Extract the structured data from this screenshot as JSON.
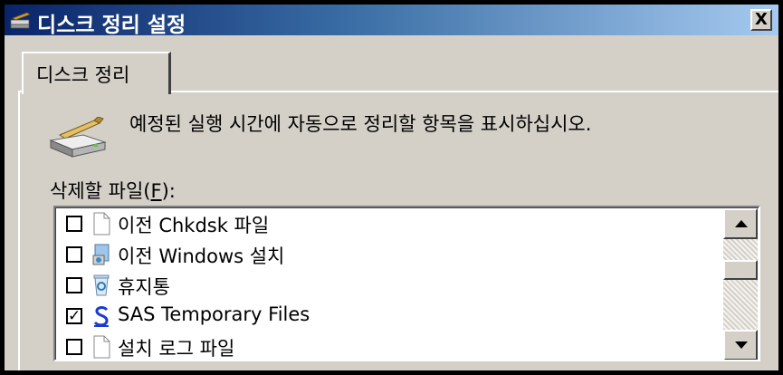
{
  "window": {
    "title": "디스크 정리 설정",
    "close_label": "X",
    "icon": "disk-cleanup-icon"
  },
  "tabs": [
    {
      "label": "디스크 정리",
      "selected": true
    }
  ],
  "main": {
    "description": "예정된 실행 시간에 자동으로 정리할 항목을 표시하십시오.",
    "files_label_prefix": "삭제할 파일(",
    "files_label_accel": "F",
    "files_label_suffix": "):",
    "items": [
      {
        "label": "이전 Chkdsk 파일",
        "checked": false,
        "icon": "blank-file-icon"
      },
      {
        "label": "이전 Windows 설치",
        "checked": false,
        "icon": "windows-setup-icon"
      },
      {
        "label": "휴지통",
        "checked": false,
        "icon": "recycle-bin-icon"
      },
      {
        "label": "SAS Temporary Files",
        "checked": true,
        "icon": "sas-icon"
      },
      {
        "label": "설치 로그 파일",
        "checked": false,
        "icon": "blank-file-icon"
      }
    ],
    "check_glyph": "✓"
  }
}
